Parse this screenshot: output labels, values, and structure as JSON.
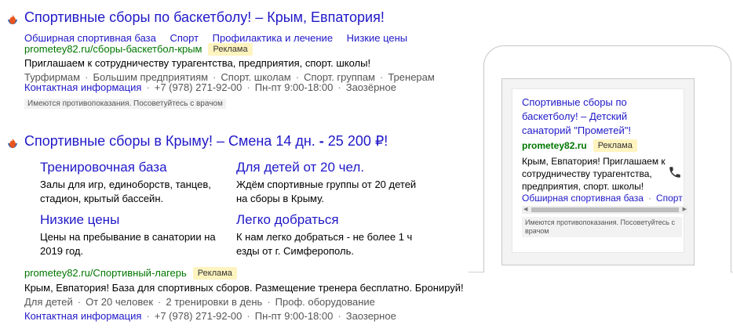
{
  "ad1": {
    "title": "Спортивные сборы по баскетболу! – Крым, Евпатория!",
    "sitelinks": [
      "Обширная спортивная база",
      "Спорт",
      "Профилактика и лечение",
      "Низкие цены"
    ],
    "url": "prometey82.ru/сборы-баскетбол-крым",
    "badge": "Реклама",
    "text": "Приглашаем к сотрудничеству турагентства, предприятия, спорт. школы!",
    "callouts": [
      "Турфирмам",
      "Большим предприятиям",
      "Спорт. школам",
      "Спорт. группам",
      "Тренерам"
    ],
    "contact_label": "Контактная информация",
    "phone": "+7 (978) 271-92-00",
    "hours": "Пн-пт 9:00-18:00",
    "location": "Заозёрное",
    "warning": "Имеются противопоказания. Посоветуйтесь с врачом"
  },
  "ad2": {
    "title_main": "Спортивные сборы в Крыму! – Смена 14 дн.",
    "title_sep": " - ",
    "title_price": "25 200 ₽!",
    "quick": [
      {
        "title": "Тренировочная база",
        "text": "Залы для игр, единоборств, танцев, стадион, крытый бассейн."
      },
      {
        "title": "Для детей от 20 чел.",
        "text": "Ждём спортивные группы от 20 детей на сборы в Крыму."
      },
      {
        "title": "Низкие цены",
        "text": "Цены на пребывание в санатории на 2019 год."
      },
      {
        "title": "Легко добраться",
        "text": "К нам легко добраться - не более 1 ч езды от г. Симферополь."
      }
    ],
    "url": "prometey82.ru/Спортивный-лагерь",
    "badge": "Реклама",
    "text": "Крым, Евпатория! База для спортивных сборов. Размещение тренера бесплатно. Бронируй!",
    "callouts": [
      "Для детей",
      "От 20 человек",
      "2 тренировки в день",
      "Проф. оборудование"
    ],
    "contact_label": "Контактная информация",
    "phone": "+7 (978) 271-92-00",
    "hours": "Пн-пт 9:00-18:00",
    "location": "Заозерное"
  },
  "mobile": {
    "title": "Спортивные сборы по баскетболу! – Детский санаторий \"Прометей\"!",
    "url": "prometey82.ru",
    "badge": "Реклама",
    "text": "Крым, Евпатория! Приглашаем к сотрудничеству турагентства, предприятия, спорт. школы!",
    "link1": "Обширная спортивная база",
    "link2": "Спорт",
    "warning": "Имеются противопоказания. Посоветуйтесь с врачом",
    "phone_icon": "phone-icon"
  },
  "colors": {
    "link": "#2018c8",
    "url": "#007700",
    "badge_bg": "#fff4bf"
  }
}
